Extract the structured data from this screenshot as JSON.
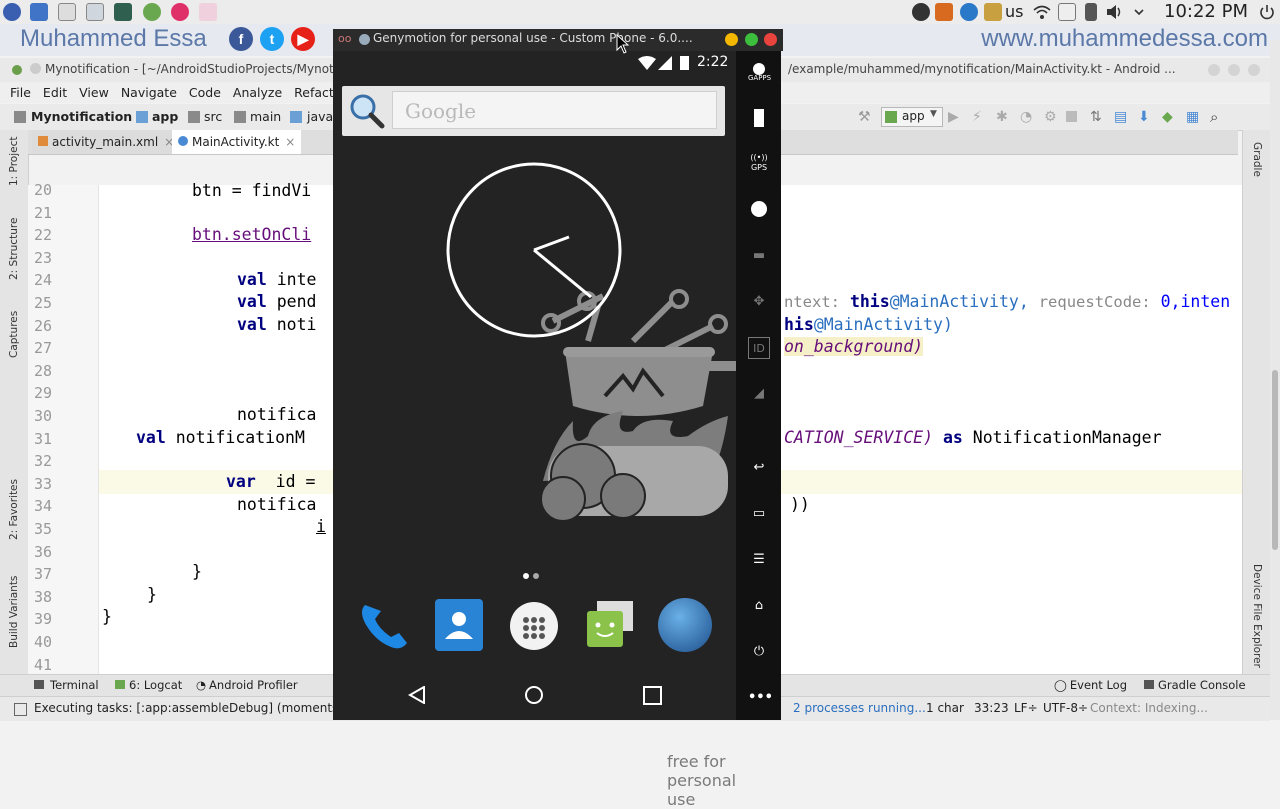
{
  "desktop": {
    "clock": "10:22 PM",
    "keyboard_layout": "us"
  },
  "banner": {
    "author": "Muhammed Essa",
    "website": "www.muhammedessa.com"
  },
  "ide": {
    "window_title_left": "Mynotification - [~/AndroidStudioProjects/Mynotif",
    "window_title_right": "/example/muhammed/mynotification/MainActivity.kt - Android ...",
    "menu": [
      "File",
      "Edit",
      "View",
      "Navigate",
      "Code",
      "Analyze",
      "Refactor"
    ],
    "breadcrumbs": [
      "Mynotification",
      "app",
      "src",
      "main",
      "java"
    ],
    "run_config": "app",
    "tabs": [
      "activity_main.xml",
      "MainActivity.kt"
    ],
    "left_tool_labels": [
      "1: Project",
      "2: Structure",
      "Captures",
      "2: Favorites",
      "Build Variants"
    ],
    "right_tool_labels": [
      "Gradle",
      "Device File Explorer"
    ],
    "line_numbers": [
      "20",
      "21",
      "22",
      "23",
      "24",
      "25",
      "26",
      "27",
      "28",
      "29",
      "30",
      "31",
      "32",
      "33",
      "34",
      "35",
      "36",
      "37",
      "38",
      "39",
      "40",
      "41"
    ],
    "code_left": {
      "l20": "btn = findVi",
      "l22": "btn.setOnCli",
      "l24_kw": "val",
      "l24": " inte",
      "l25_kw": "val",
      "l25": " pend",
      "l26_kw": "val",
      "l26": " noti",
      "l30": "notifica",
      "l31_kw": "val",
      "l31": " notificationM",
      "l33_kw": "var",
      "l33": "  id =",
      "l34": "notifica",
      "l35": "i",
      "l37": "}",
      "l38": "}",
      "l39": "}"
    },
    "code_right": {
      "l25_hint1": "ntext:",
      "l25_this": "this",
      "l25_main": "@MainActivity,",
      "l25_hint2": "requestCode:",
      "l25_rest": "0,inten",
      "l26_this": "his",
      "l26_rest": "@MainActivity)",
      "l27": "on_background)",
      "l31_a": "CATION_SERVICE)",
      "l31_as": "as",
      "l31_b": "NotificationManager",
      "l34": "))"
    },
    "bottom_tools": [
      "Terminal",
      "6: Logcat",
      "Android Profiler",
      "Event Log",
      "Gradle Console"
    ],
    "status": {
      "task": "Executing tasks: [:app:assembleDebug] (moments ag",
      "processes": "2 processes running...",
      "chars": "1 char",
      "position": "33:23",
      "line_sep": "LF÷",
      "encoding": "UTF-8÷",
      "context": "Context: Indexing..."
    }
  },
  "emulator": {
    "title": "Genymotion for personal use - Custom Phone - 6.0....",
    "status_time": "2:22",
    "search_placeholder": "Google",
    "watermark": "free for personal use",
    "side_labels": {
      "gapps": "GAPPS",
      "gps": "GPS",
      "id": "ID"
    }
  }
}
